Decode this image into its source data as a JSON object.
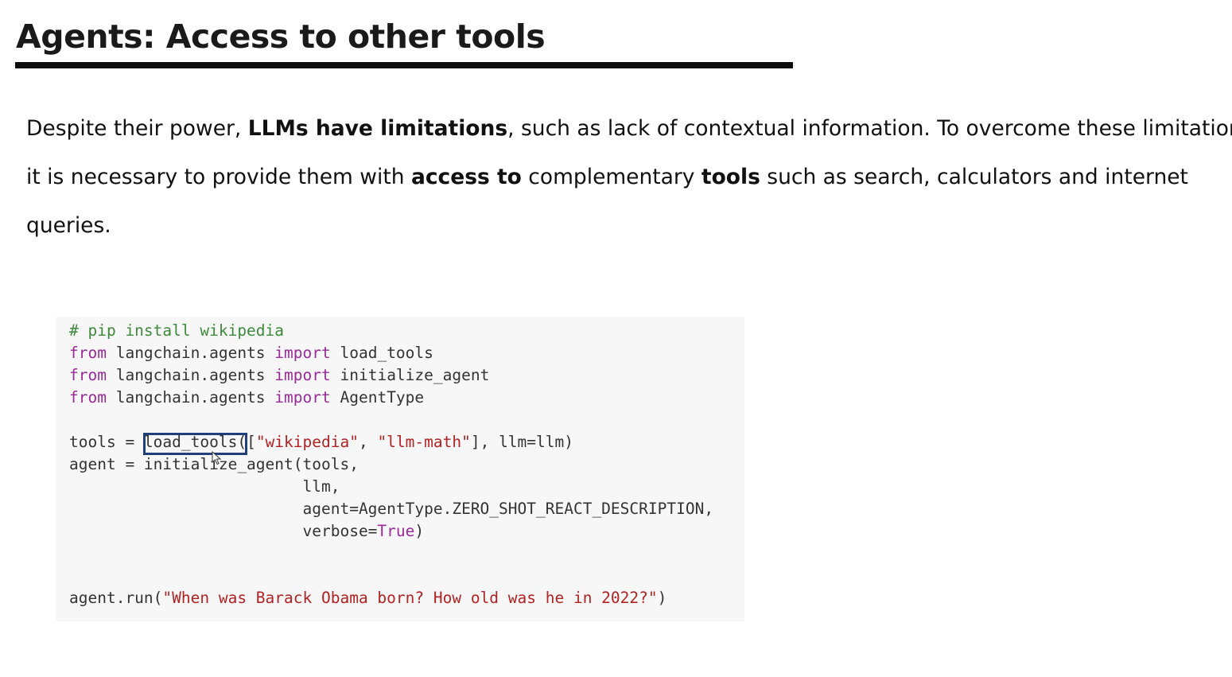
{
  "slide": {
    "title": "Agents: Access to other tools",
    "paragraph": {
      "line1_pre": "Despite their power, ",
      "line1_bold": "LLMs have limitations",
      "line1_post": ", such as lack of contextual information. To overcome these limitations,",
      "line2_pre": "it is necessary to provide them with ",
      "line2_bold1": "access to",
      "line2_mid": " complementary ",
      "line2_bold2": "tools",
      "line2_post": " such as search, calculators and internet",
      "line3": "queries."
    }
  },
  "code": {
    "comment": "# pip install wikipedia",
    "kw_from": "from",
    "kw_import": "import",
    "module": " langchain.agents ",
    "import1": " load_tools",
    "import2": " initialize_agent",
    "import3": " AgentType",
    "tools_assign": "tools = ",
    "load_call": "load_tools(",
    "load_bracket_open": "[",
    "str_wikipedia": "\"wikipedia\"",
    "comma_sp": ", ",
    "str_llm_math": "\"llm-math\"",
    "load_tail": "], llm=llm)",
    "agent_line": "agent = initialize_agent(tools,",
    "indent": "                         ",
    "arg_llm": "llm,",
    "arg_agent": "agent=AgentType.ZERO_SHOT_REACT_DESCRIPTION,",
    "arg_verbose_pre": "verbose=",
    "arg_true": "True",
    "arg_verbose_post": ")",
    "run_pre": "agent.run(",
    "run_string": "\"When was Barack Obama born? How old was he in 2022?\"",
    "run_post": ")"
  },
  "colors": {
    "comment": "#3d8a3d",
    "keyword": "#9a2a9a",
    "string": "#b22222",
    "highlight_border": "#1f3f7a",
    "code_background": "#f7f7f7"
  },
  "icons": {
    "cursor": "mouse-pointer-icon"
  }
}
